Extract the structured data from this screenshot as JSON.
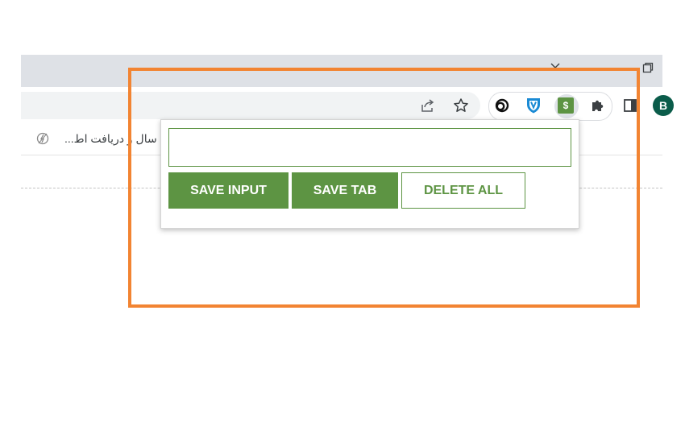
{
  "colors": {
    "accent_green": "#5d9443",
    "highlight_orange": "#f28432",
    "tab_strip": "#dee1e6",
    "omnibox": "#f1f3f4",
    "avatar_bg": "#0b5c4a"
  },
  "toolbar": {
    "icons": [
      "share-icon",
      "star-icon",
      "link-extension-icon",
      "shield-v-extension-icon",
      "dollar-extension-icon",
      "puzzle-icon",
      "side-panel-icon"
    ],
    "dollar_glyph": "$",
    "avatar_letter": "B"
  },
  "bookmarks": {
    "item_label": "...سال و دریافت اط"
  },
  "popup": {
    "input_value": "",
    "input_placeholder": "",
    "buttons": {
      "save_input": "SAVE INPUT",
      "save_tab": "SAVE TAB",
      "delete_all": "DELETE ALL"
    }
  }
}
